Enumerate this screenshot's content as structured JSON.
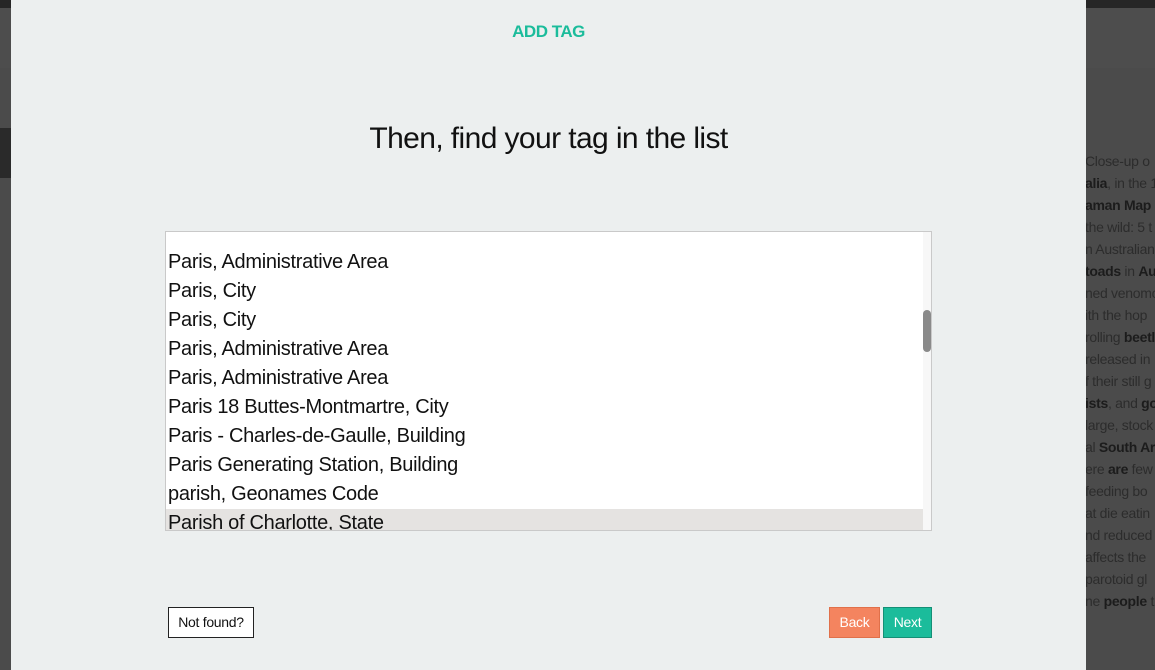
{
  "modal": {
    "title": "ADD TAG",
    "heading": "Then, find your tag in the list",
    "tag_list": {
      "items": [
        "Paris, Administrative Area",
        "Paris, City",
        "Paris, City",
        "Paris, Administrative Area",
        "Paris, Administrative Area",
        "Paris 18 Buttes-Montmartre, City",
        "Paris - Charles-de-Gaulle, Building",
        "Paris Generating Station, Building",
        "parish, Geonames Code",
        "Parish of Charlotte, State"
      ],
      "selected_item": "Parish of Charlotte, State"
    },
    "buttons": {
      "not_found": "Not found?",
      "back": "Back",
      "next": "Next"
    }
  },
  "background": {
    "text_lines": [
      [
        "Close-up o"
      ],
      [
        "alia",
        ", in the 1"
      ],
      [
        "aman Map"
      ],
      [
        "the wild: 5 t"
      ],
      [
        "n Australian"
      ],
      [
        "toads",
        " in ",
        "Au"
      ],
      [
        "ned venomo"
      ],
      [
        "ith the hop"
      ],
      [
        "rolling ",
        "beetl"
      ],
      [
        "released in"
      ],
      [
        "f their still g"
      ],
      [
        "ists",
        ", and ",
        "gov"
      ],
      [
        "large, stock"
      ],
      [
        "al ",
        "South Ar"
      ],
      [
        "ere ",
        "are",
        " few"
      ],
      [
        "feeding bo"
      ],
      [
        "at die eatin"
      ],
      [
        "nd reduced"
      ],
      [
        "affects the"
      ],
      [
        "parotoid gl"
      ],
      [
        "ne ",
        "people",
        " t"
      ]
    ],
    "bold_flags": [
      [
        false
      ],
      [
        true,
        false
      ],
      [
        true
      ],
      [
        false
      ],
      [
        false
      ],
      [
        true,
        false,
        true
      ],
      [
        false
      ],
      [
        false
      ],
      [
        false,
        true
      ],
      [
        false
      ],
      [
        false
      ],
      [
        true,
        false,
        true
      ],
      [
        false
      ],
      [
        false,
        true
      ],
      [
        false,
        true,
        false
      ],
      [
        false
      ],
      [
        false
      ],
      [
        false
      ],
      [
        false
      ],
      [
        false
      ],
      [
        false,
        true,
        false
      ]
    ]
  },
  "colors": {
    "accent": "#1bbc9b",
    "back_button": "#f4845f",
    "modal_bg": "#ecefef",
    "selected_row": "#e5e3e1"
  }
}
